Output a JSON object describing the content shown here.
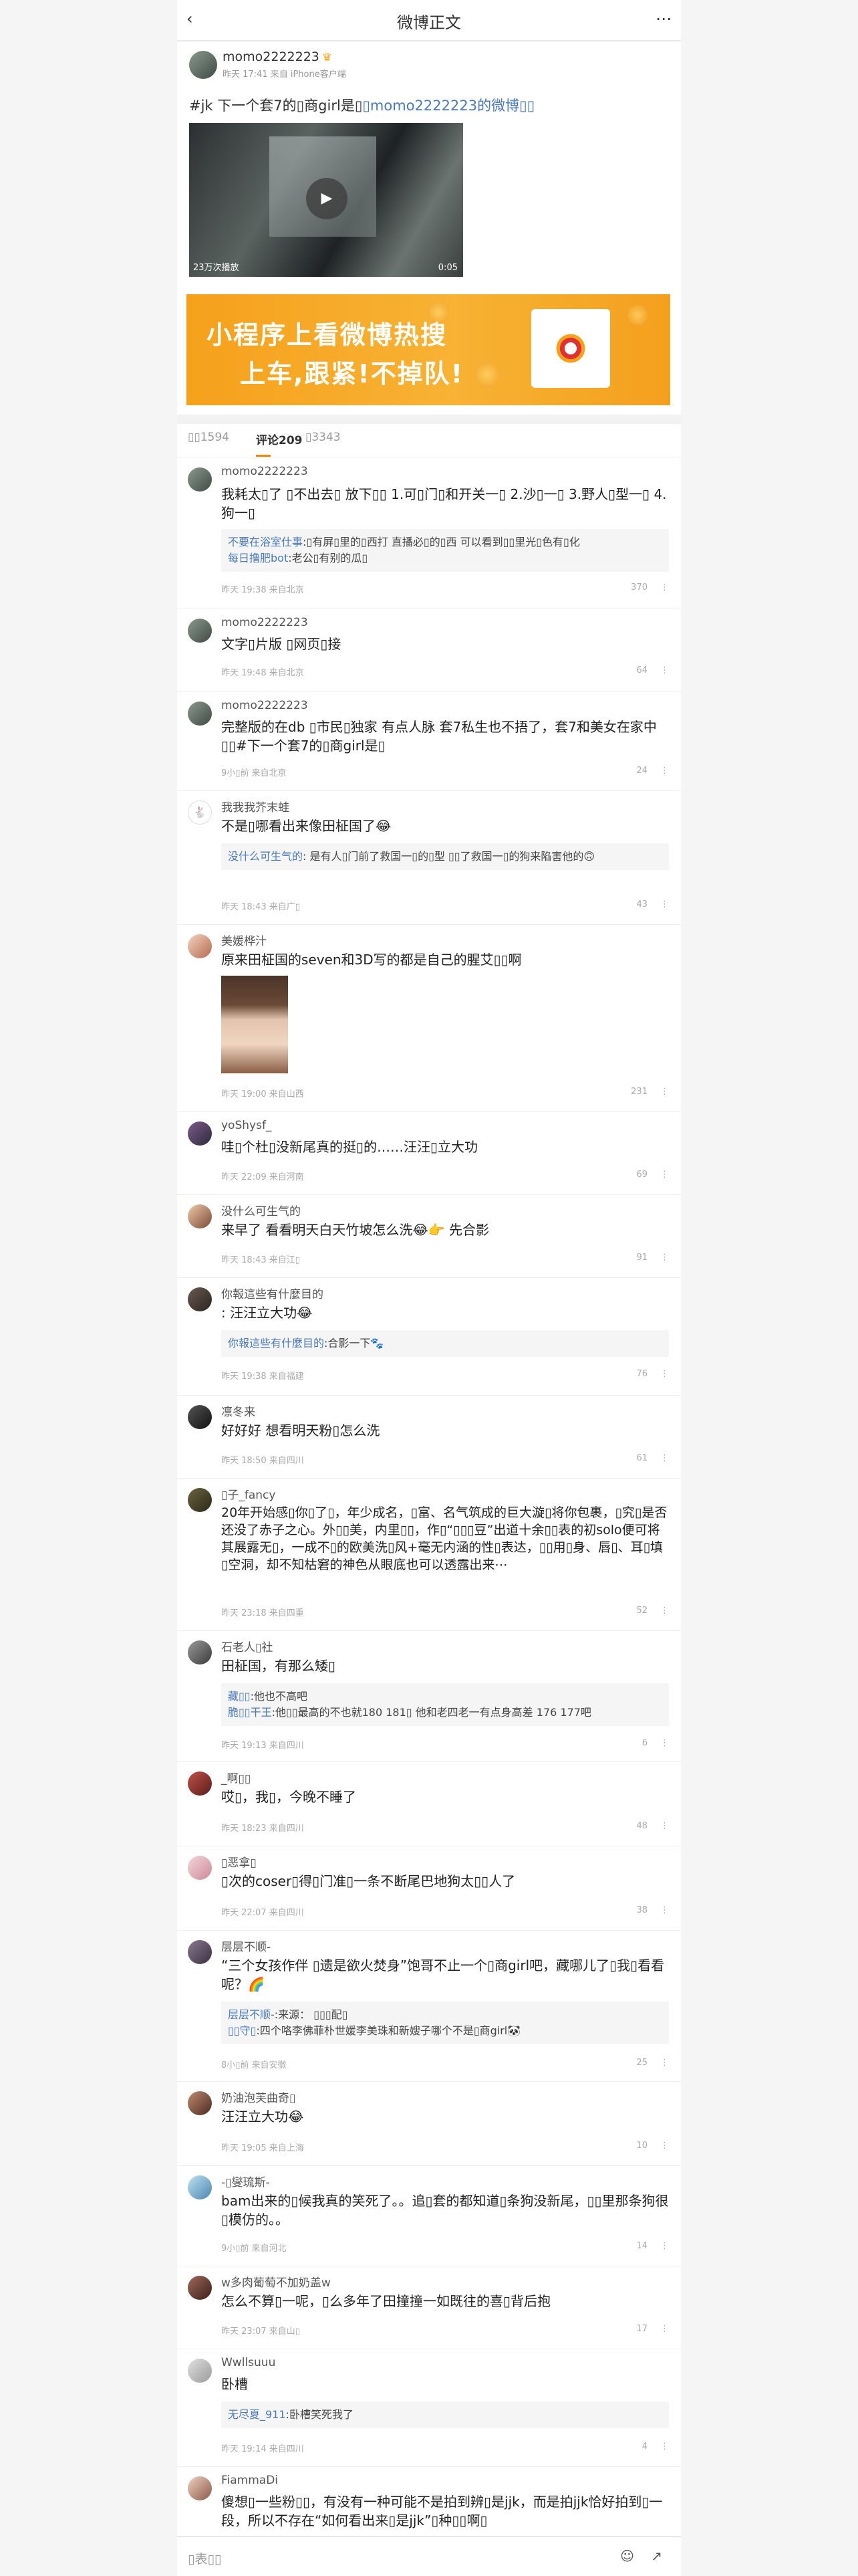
{
  "colors": {
    "accent": "#ff8200",
    "link": "#4a7ab8",
    "banner": "#f5a11c"
  },
  "topbar": {
    "title": "微博正文",
    "back_icon": "back-arrow-icon",
    "more_icon": "more-icon"
  },
  "post": {
    "author": "momo2222223",
    "meta": "昨天 17:41 来自 iPhone客户端",
    "text_prefix": "#jk 下一个套7的▯商girl是▯",
    "text_link": "▯momo2222223的微博▯▯",
    "video": {
      "views": "23万次播放",
      "duration": "0:05"
    }
  },
  "banner": {
    "line1": "小程序上看微博热搜",
    "line2": "上车,跟紧!不掉队!"
  },
  "tabs": [
    {
      "label": "▯▯1594"
    },
    {
      "label": "评论209"
    },
    {
      "label": "▯3343"
    }
  ],
  "comments": [
    {
      "name": "momo2222223",
      "text": "我耗太▯了 ▯不出去▯ 放下▯▯ 1.可▯门▯和开关一▯ 2.沙▯一▯ 3.野人▯型一▯ 4.狗一▯",
      "reply_name": "不要在浴室仕事",
      "reply_text": ":▯有屏▯里的▯西打 直播必▯的▯西 可以看到▯▯里光▯色有▯化",
      "reply_name2": "每日撸肥bot",
      "reply_text2": ":老公▯有别的瓜▯",
      "foot": "昨天 19:38 来自北京",
      "likes": "370"
    },
    {
      "name": "momo2222223",
      "text": "文字▯片版 ▯网页▯接",
      "foot": "昨天 19:48 来自北京",
      "likes": "64"
    },
    {
      "name": "momo2222223",
      "text": "完整版的在db ▯市民▯独家 有点人脉 套7私生也不捂了，套7和美女在家中▯▯#下一个套7的▯商girl是▯",
      "foot": "9小▯前 来自北京",
      "likes": "24"
    },
    {
      "name": "我我我芥末蛙",
      "text": "不是▯哪看出来像田柾国了😂",
      "reply_name": "没什么可生气的",
      "reply_text": ": 是有人▯门前了救国一▯的▯型 ▯▯了救国一▯的狗来陷害他的🙃",
      "foot": "昨天 18:43 来自广▯",
      "likes": "43"
    },
    {
      "name": "美媛桦汁",
      "text": "原来田柾国的seven和3D写的都是自己的腥艾▯▯啊",
      "foot": "昨天 19:00 来自山西",
      "likes": "231"
    },
    {
      "name": "yoShysf_",
      "text": "哇▯个杜▯没新尾真的挺▯的……汪汪▯立大功",
      "foot": "昨天 22:09 来自河南",
      "likes": "69"
    },
    {
      "name": "没什么可生气的",
      "text": "来早了 看看明天白天竹坡怎么洗😂👉 先合影",
      "foot": "昨天 18:43 来自江▯",
      "likes": "91"
    },
    {
      "name": "你報這些有什麼目的",
      "text": ": 汪汪立大功😂",
      "reply_name": "你報這些有什麼目的",
      "reply_text": ":合影一下🐾",
      "foot": "昨天 19:38 来自福建",
      "likes": "76"
    },
    {
      "name": "凛冬来",
      "text": "好好好 想看明天粉▯怎么洗",
      "foot": "昨天 18:50 来自四川",
      "likes": "61"
    },
    {
      "name": "▯子_fancy",
      "text": "20年开始感▯你▯了▯，年少成名，▯富、名气筑成的巨大漩▯将你包裹，▯究▯是否还没了赤子之心。外▯▯美，内里▯▯，作▯“▯▯▯豆”出道十余▯▯表的初solo便可将其展露无▯，一成不▯的欧美洗▯风+毫无内涵的性▯表达，▯▯用▯身、唇▯、耳▯填▯空洞，却不知枯窘的神色从眼底也可以透露出来⋯",
      "foot": "昨天 23:18 来自四重",
      "likes": "52"
    },
    {
      "name": "石老人▯社",
      "text": "田柾国，有那么矮▯",
      "reply_name": "藏▯▯",
      "reply_text": ":他也不高吧",
      "reply_name2": "脆▯▯干王",
      "reply_text2": ":他▯▯最高的不也就180 181▯ 他和老四老一有点身高差 176 177吧",
      "foot": "昨天 19:13 来自四川",
      "likes": "6"
    },
    {
      "name": "_啊▯▯",
      "text": "哎▯，我▯，今晚不睡了",
      "foot": "昨天 18:23 来自四川",
      "likes": "48"
    },
    {
      "name": "▯恶拿▯",
      "text": "▯次的coser▯得▯门准▯一条不断尾巴地狗太▯▯人了",
      "foot": "昨天 22:07 来自四川",
      "likes": "38"
    },
    {
      "name": "层层不顺-",
      "text": "“三个女孩作伴 ▯遗是欲火焚身”饱哥不止一个▯商girl吧，藏哪儿了▯我▯看看呢？🌈",
      "reply_name": "层层不顺-",
      "reply_text": ":来源： ▯▯▯配▯",
      "reply_name2": "▯▯守▯",
      "reply_text2": ":四个咯李佛菲朴世媛李美珠和新嫂子哪个不是▯商girl🐼",
      "foot": "8小▯前 来自安徽",
      "likes": "25"
    },
    {
      "name": "奶油泡芙曲奇▯",
      "text": "汪汪立大功😂",
      "foot": "昨天 19:05 来自上海",
      "likes": "10"
    },
    {
      "name": "-▯燮琉斯-",
      "text": "bam出来的▯候我真的笑死了。。追▯套的都知道▯条狗没新尾，▯▯里那条狗很▯模仿的。。",
      "foot": "9小▯前 来自河北",
      "likes": "14"
    },
    {
      "name": "w多肉葡萄不加奶盖w",
      "text": "怎么不算▯一呢，▯么多年了田撞撞一如既往的喜▯背后抱",
      "foot": "昨天 23:07 来自山▯",
      "likes": "17"
    },
    {
      "name": "Wwllsuuu",
      "text": "卧槽",
      "reply_name": "无尽夏_911",
      "reply_text": ":卧槽笑死我了",
      "foot": "昨天 19:14 来自四川",
      "likes": "4"
    },
    {
      "name": "FiammaDi",
      "text": "傻想▯一些粉▯▯，有没有一种可能不是拍到辨▯是jjk，而是拍jjk恰好拍到▯一段，所以不存在“如何看出来▯是jjk”▯种▯▯啊▯"
    }
  ],
  "bottombar": {
    "input_placeholder": "▯表▯▯",
    "icon1": "emoji-icon",
    "icon2": "share-icon"
  }
}
